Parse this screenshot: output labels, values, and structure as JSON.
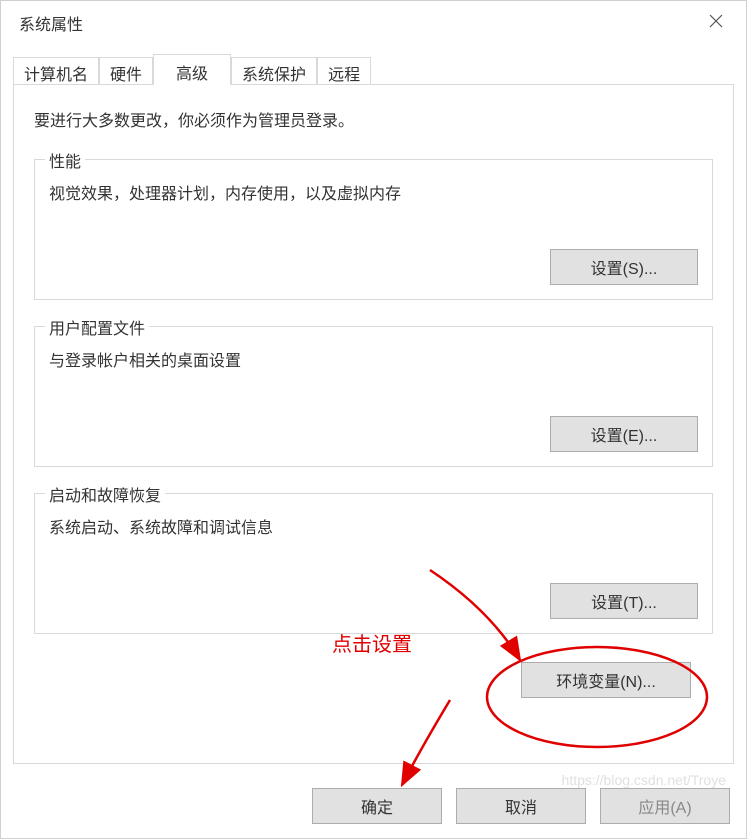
{
  "window": {
    "title": "系统属性"
  },
  "tabs": {
    "computer_name": "计算机名",
    "hardware": "硬件",
    "advanced": "高级",
    "system_protection": "系统保护",
    "remote": "远程"
  },
  "content": {
    "admin_note": "要进行大多数更改，你必须作为管理员登录。",
    "performance": {
      "title": "性能",
      "desc": "视觉效果，处理器计划，内存使用，以及虚拟内存",
      "button": "设置(S)..."
    },
    "profiles": {
      "title": "用户配置文件",
      "desc": "与登录帐户相关的桌面设置",
      "button": "设置(E)..."
    },
    "startup": {
      "title": "启动和故障恢复",
      "desc": "系统启动、系统故障和调试信息",
      "button": "设置(T)..."
    },
    "env_button": "环境变量(N)..."
  },
  "footer": {
    "ok": "确定",
    "cancel": "取消",
    "apply": "应用(A)"
  },
  "annotation": {
    "label": "点击设置"
  },
  "watermark": "https://blog.csdn.net/Troye"
}
